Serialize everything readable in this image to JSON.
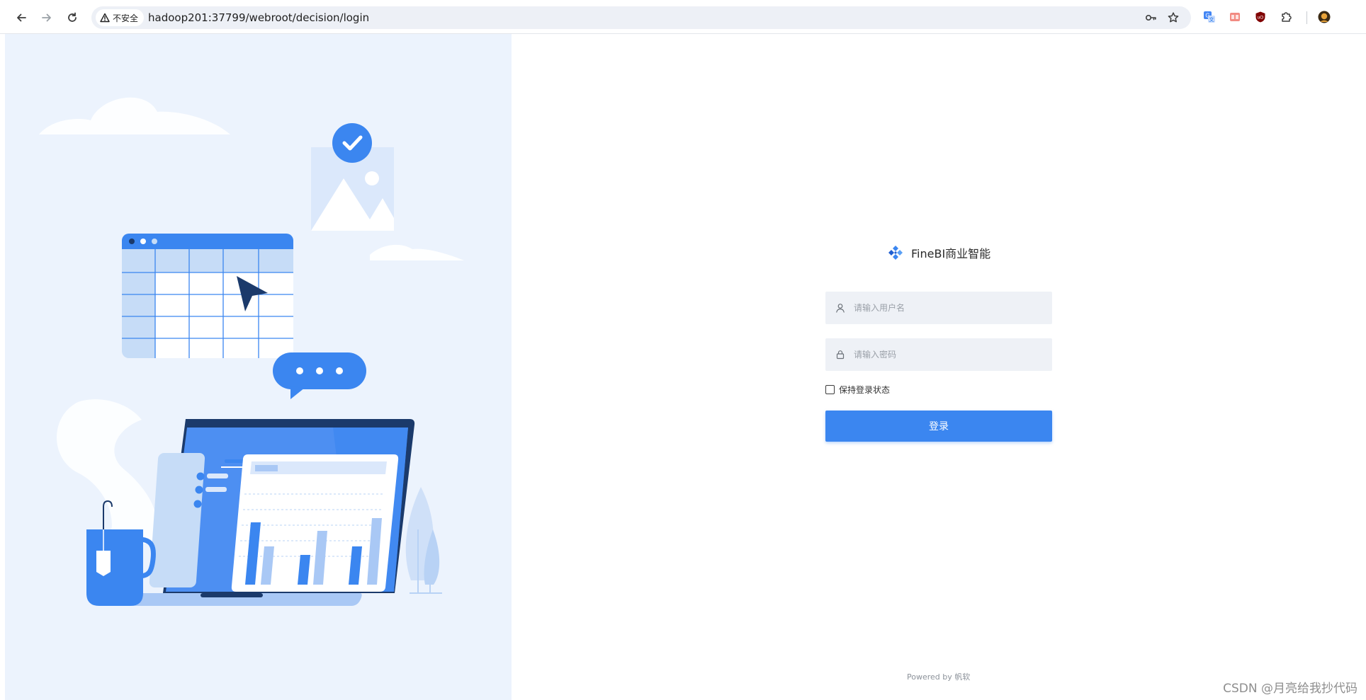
{
  "browser": {
    "security_label": "不安全",
    "url": "hadoop201:37799/webroot/decision/login"
  },
  "login": {
    "brand": "FineBI商业智能",
    "username_placeholder": "请输入用户名",
    "password_placeholder": "请输入密码",
    "remember_label": "保持登录状态",
    "remember_checked": false,
    "submit_label": "登录"
  },
  "footer": {
    "powered_by": "Powered by 帆软"
  },
  "watermark": "CSDN @月亮给我抄代码",
  "colors": {
    "accent": "#3b86f0",
    "field_bg": "#eef1f6",
    "illustration_bg": "#ecf3fd",
    "navy": "#1b3a6b"
  },
  "icons": {
    "back": "arrow-left-icon",
    "forward": "arrow-right-icon",
    "reload": "reload-icon",
    "warning": "warning-triangle-icon",
    "password_key": "key-icon",
    "bookmark": "star-icon",
    "translate": "translate-icon",
    "extensions": "puzzle-icon",
    "user": "user-icon",
    "lock": "lock-icon",
    "brand_logo": "finebi-logo-icon"
  }
}
